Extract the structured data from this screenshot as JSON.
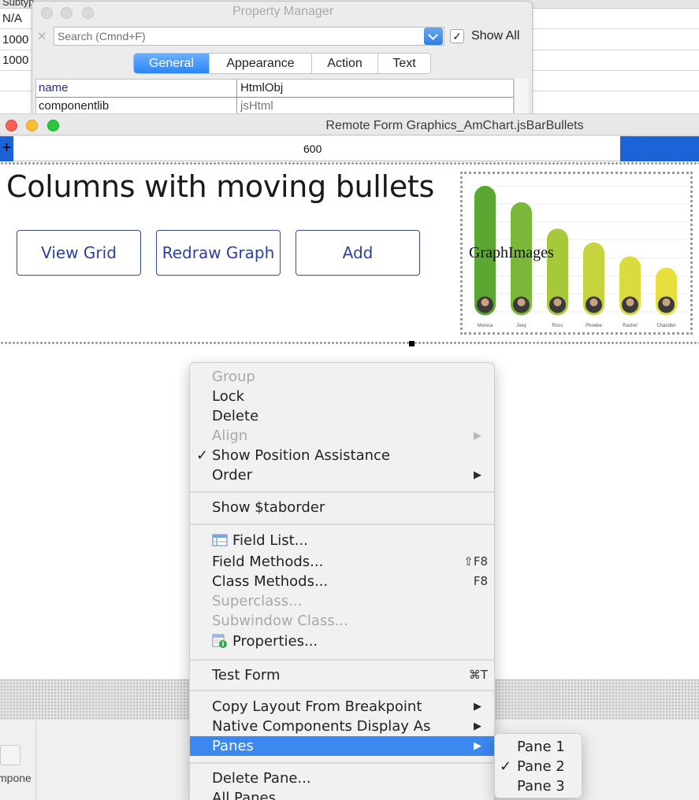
{
  "background_grid": {
    "header_text": "Subtyp",
    "rows": [
      "N/A",
      "1000",
      "1000"
    ]
  },
  "property_manager": {
    "title": "Property Manager",
    "search_placeholder": "Search (Cmnd+F)",
    "show_all_label": "Show All",
    "show_all_checked": true,
    "tabs": [
      {
        "label": "General",
        "active": true
      },
      {
        "label": "Appearance",
        "active": false
      },
      {
        "label": "Action",
        "active": false
      },
      {
        "label": "Text",
        "active": false
      }
    ],
    "properties": [
      {
        "key": "name",
        "value": "HtmlObj"
      },
      {
        "key": "componentlib",
        "value": "jsHtml"
      }
    ]
  },
  "remote_form": {
    "title": "Remote Form Graphics_AmChart.jsBarBullets",
    "ruler_value": "600",
    "ruler_plus": "+",
    "headline": "Columns with moving bullets",
    "buttons": [
      "View Grid",
      "Redraw Graph",
      "Add"
    ],
    "graph_label": "GraphImages"
  },
  "chart_data": {
    "type": "bar",
    "categories": [
      "Monica",
      "Joey",
      "Ross",
      "Phoebe",
      "Rachel",
      "Chandler"
    ],
    "values": [
      100,
      87,
      66,
      55,
      44,
      35
    ],
    "ylim": [
      0,
      100
    ],
    "colors": [
      "#5aa731",
      "#7bb83a",
      "#a7c83b",
      "#c6d33e",
      "#d9db3f",
      "#e6df3e"
    ]
  },
  "bottom_strip": {
    "partial_label": "mpone"
  },
  "context_menu": {
    "items": [
      {
        "label": "Group",
        "disabled": true
      },
      {
        "label": "Lock"
      },
      {
        "label": "Delete"
      },
      {
        "label": "Align",
        "disabled": true,
        "submenu": true
      },
      {
        "label": "Show Position Assistance",
        "checked": true
      },
      {
        "label": "Order",
        "submenu": true
      },
      {
        "label": "Show $taborder"
      },
      {
        "label": "Field List...",
        "icon": "field-list-icon"
      },
      {
        "label": "Field Methods...",
        "shortcut": "⇧F8"
      },
      {
        "label": "Class Methods...",
        "shortcut": "F8"
      },
      {
        "label": "Superclass...",
        "disabled": true
      },
      {
        "label": "Subwindow Class...",
        "disabled": true
      },
      {
        "label": "Properties...",
        "icon": "properties-icon"
      },
      {
        "label": "Test Form",
        "shortcut": "⌘T"
      },
      {
        "label": "Copy Layout From Breakpoint",
        "submenu": true
      },
      {
        "label": "Native Components Display As",
        "submenu": true
      },
      {
        "label": "Panes",
        "submenu": true,
        "highlighted": true
      },
      {
        "label": "Delete Pane..."
      },
      {
        "label": "All Panes"
      }
    ],
    "check_glyph": "✓",
    "arrow_glyph": "▶"
  },
  "panes_submenu": {
    "items": [
      {
        "label": "Pane 1"
      },
      {
        "label": "Pane 2",
        "checked": true
      },
      {
        "label": "Pane 3"
      }
    ]
  },
  "colors": {
    "accent_blue": "#3b88f1",
    "ruler_blue": "#1d63d8",
    "button_border": "#3647a3"
  }
}
